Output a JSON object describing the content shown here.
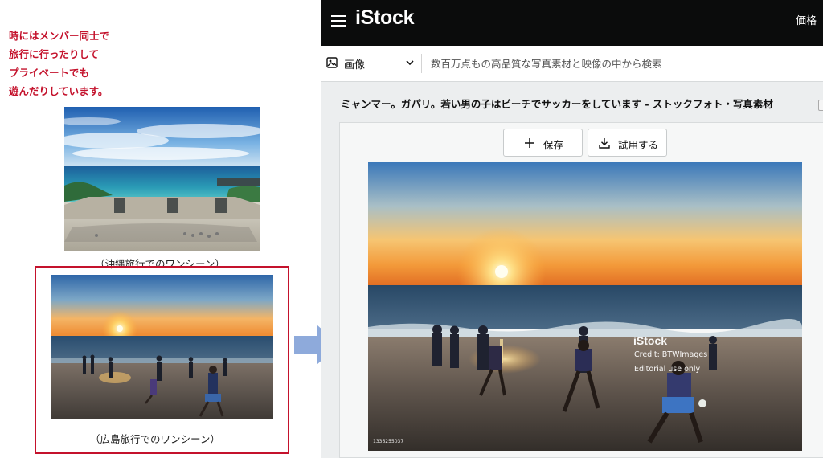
{
  "document": {
    "intro_lines": [
      "時にはメンバー同士で",
      "旅行に行ったりして",
      "プライベートでも",
      "遊んだりしています。"
    ],
    "caption_okinawa": "（沖縄旅行でのワンシーン）",
    "caption_hiroshima": "（広島旅行でのワンシーン）",
    "text_color": "#c4122c",
    "highlight_color": "#c4122c",
    "arrow_color": "#8eaadb"
  },
  "istock": {
    "logo": "iStock",
    "nav_pricing": "価格",
    "media_type": "画像",
    "search_placeholder": "数百万点もの高品質な写真素材と映像の中から検索",
    "asset_title": "ミャンマー。ガパリ。若い男の子はビーチでサッカーをしています - ストックフォト・写真素材",
    "save_label": "保存",
    "try_label": "試用する",
    "watermark_logo": "iStock",
    "watermark_credit": "Credit: BTWImages",
    "watermark_editorial": "Editorial use only",
    "image_id": "1336255037",
    "icons": [
      "menu-icon",
      "image-icon",
      "chevron-down-icon",
      "plus-icon",
      "download-icon"
    ]
  }
}
